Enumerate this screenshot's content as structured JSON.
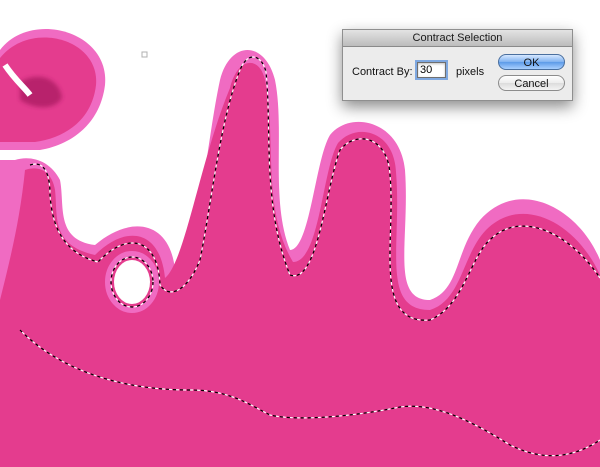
{
  "dialog": {
    "title": "Contract Selection",
    "contract_label": "Contract By:",
    "contract_value": "30",
    "unit_label": "pixels",
    "ok_label": "OK",
    "cancel_label": "Cancel"
  },
  "colors": {
    "outer_glow": "#f06bc2",
    "letter_fill": "#e43c8e",
    "selection_dash": "#000000",
    "ok_button": "#6fa6ee",
    "dialog_bg": "#ececec"
  }
}
